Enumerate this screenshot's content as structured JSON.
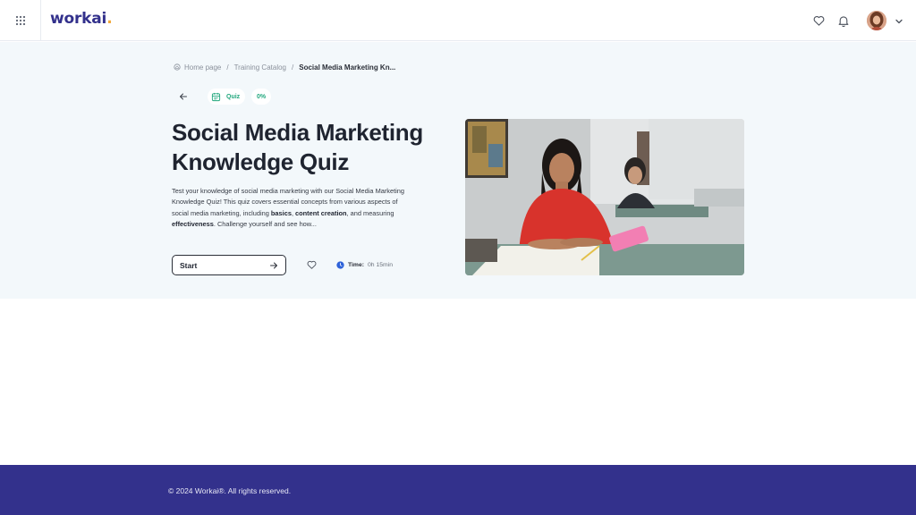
{
  "header": {
    "logo_text": "workai",
    "logo_dot": ".",
    "brand_color": "#33318c",
    "accent_color": "#f2a93b",
    "icons": [
      "apps-grid-icon",
      "heart-icon",
      "bell-icon",
      "chevron-down-icon"
    ]
  },
  "breadcrumb": {
    "items": [
      {
        "label": "Home page",
        "icon": "home-icon"
      },
      {
        "label": "Training Catalog"
      },
      {
        "label": "Social Media Marketing Kn..."
      }
    ],
    "separator": "/"
  },
  "course": {
    "type_label": "Quiz",
    "progress": "0%",
    "title": "Social Media Marketing Knowledge Quiz",
    "description": {
      "intro": "Test your knowledge of social media marketing with our Social Media Marketing Knowledge Quiz! This quiz covers essential concepts from various aspects of social media marketing, including ",
      "bold1": "basics",
      "mid1": ", ",
      "bold2": "content creation",
      "mid2": ", and measuring ",
      "bold3": "effectiveness",
      "outro": ". Challenge yourself and see how..."
    },
    "start_label": "Start",
    "time_label": "Time:",
    "time_value": "0h 15min",
    "status_color": "#23a87e"
  },
  "footer": {
    "text": "© 2024 Workai®. All rights reserved."
  }
}
